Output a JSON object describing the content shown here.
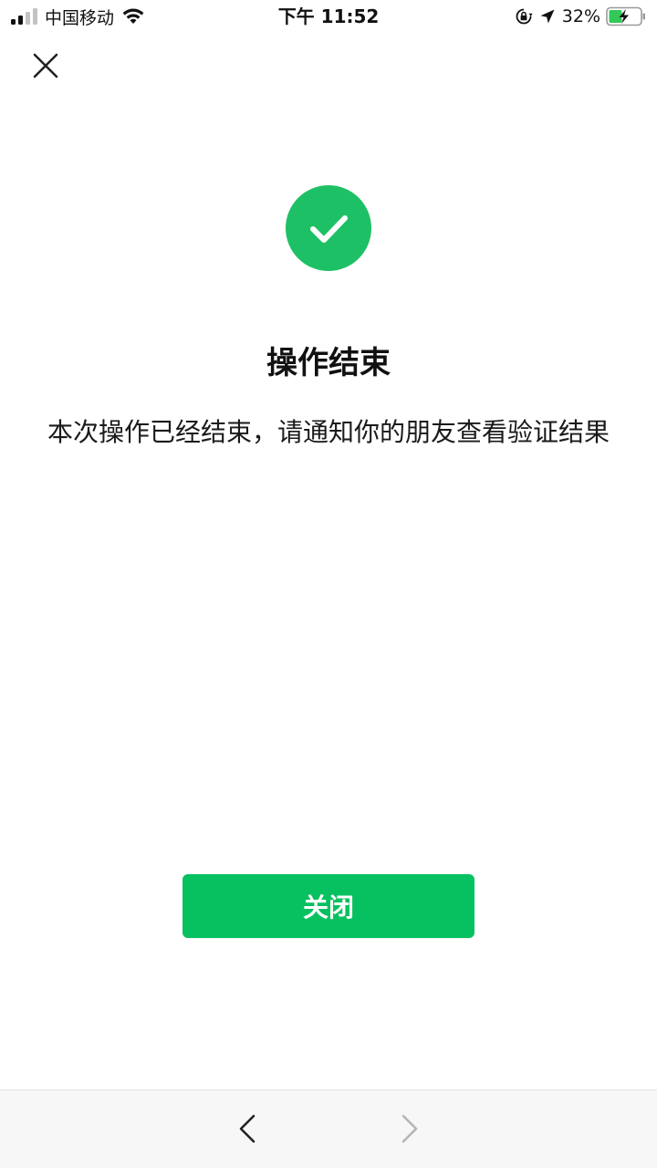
{
  "status_bar": {
    "carrier": "中国移动",
    "time": "下午 11:52",
    "battery_percent": "32%",
    "icons": [
      "signal-icon",
      "wifi-icon",
      "orientation-lock-icon",
      "location-icon",
      "battery-charging-icon"
    ]
  },
  "header": {
    "close_icon": "close-icon"
  },
  "result": {
    "icon": "checkmark-icon",
    "icon_color": "#1ec065",
    "title": "操作结束",
    "description": "本次操作已经结束，请通知你的朋友查看验证结果"
  },
  "actions": {
    "close_label": "关闭",
    "button_color": "#07c160"
  },
  "bottom_nav": {
    "back_icon": "chevron-left-icon",
    "forward_icon": "chevron-right-icon",
    "forward_enabled": false
  }
}
